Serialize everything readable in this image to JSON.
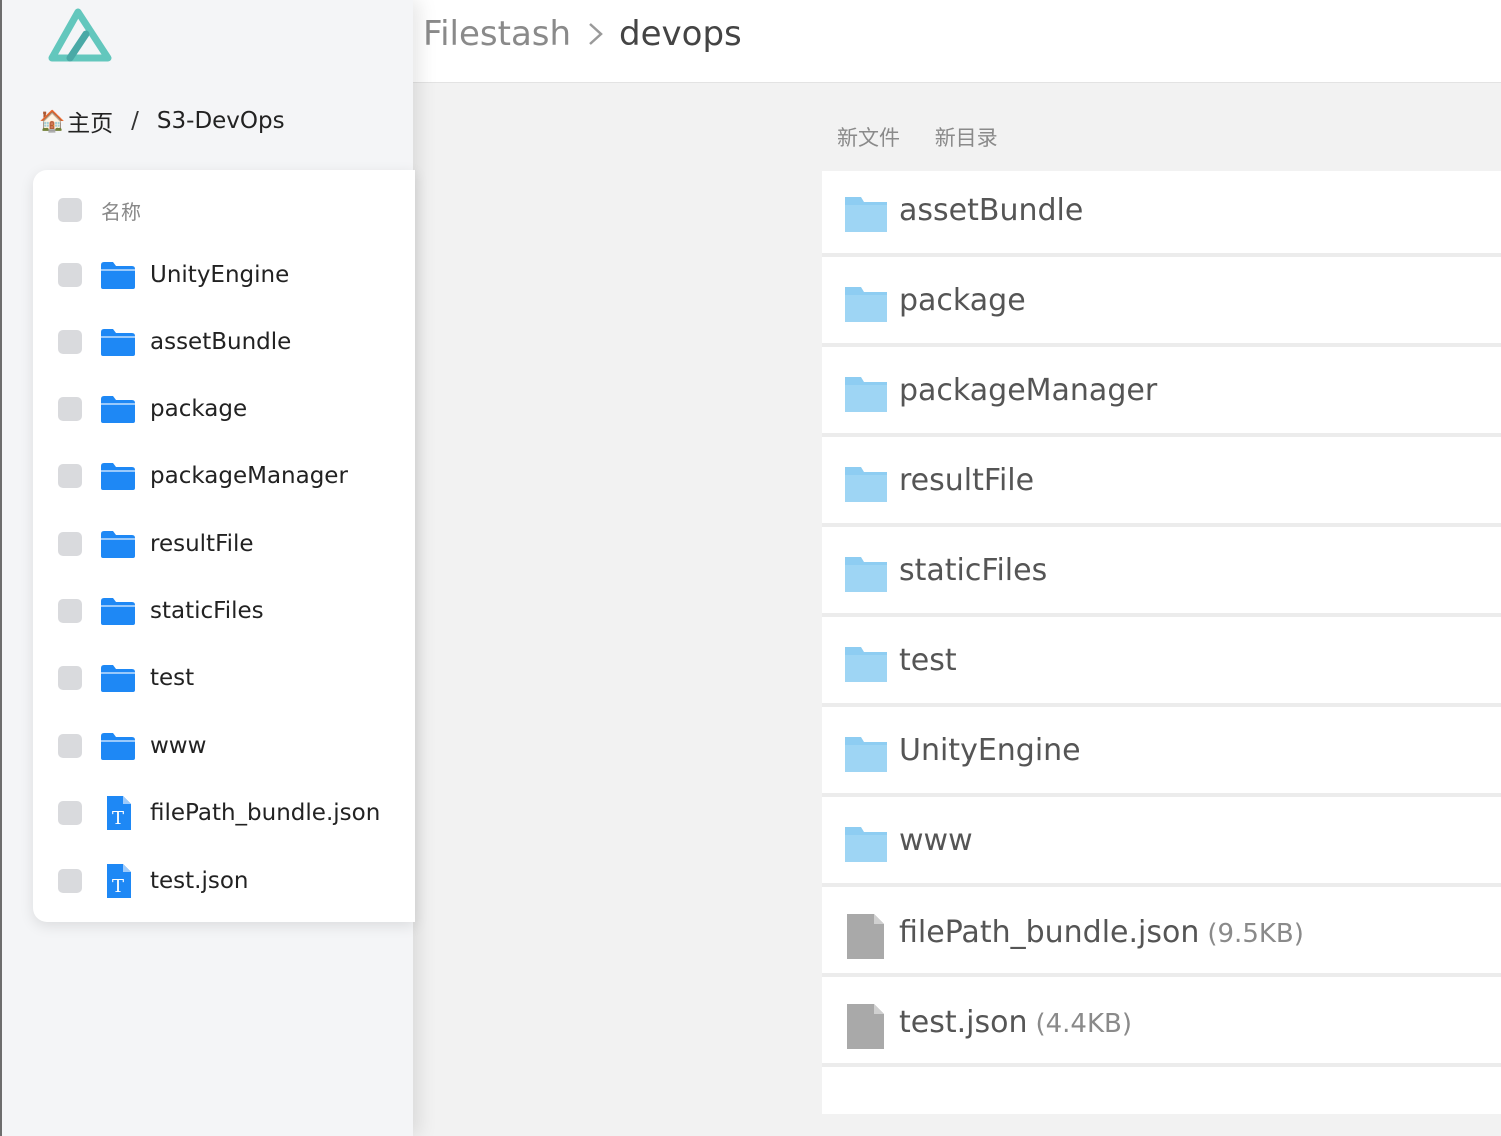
{
  "left": {
    "breadcrumb": {
      "home_icon": "🏠",
      "home": "主页",
      "separator": "/",
      "current": "S3-DevOps"
    },
    "table": {
      "header": "名称",
      "rows": [
        {
          "name": "UnityEngine",
          "type": "folder"
        },
        {
          "name": "assetBundle",
          "type": "folder"
        },
        {
          "name": "package",
          "type": "folder"
        },
        {
          "name": "packageManager",
          "type": "folder"
        },
        {
          "name": "resultFile",
          "type": "folder"
        },
        {
          "name": "staticFiles",
          "type": "folder"
        },
        {
          "name": "test",
          "type": "folder"
        },
        {
          "name": "www",
          "type": "folder"
        },
        {
          "name": "filePath_bundle.json",
          "type": "text-file"
        },
        {
          "name": "test.json",
          "type": "text-file"
        }
      ]
    }
  },
  "right": {
    "breadcrumb": {
      "app": "Filestash",
      "current": "devops"
    },
    "actions": {
      "new_file": "新文件",
      "new_folder": "新目录"
    },
    "files": [
      {
        "name": "assetBundle",
        "type": "folder",
        "size": ""
      },
      {
        "name": "package",
        "type": "folder",
        "size": ""
      },
      {
        "name": "packageManager",
        "type": "folder",
        "size": ""
      },
      {
        "name": "resultFile",
        "type": "folder",
        "size": ""
      },
      {
        "name": "staticFiles",
        "type": "folder",
        "size": ""
      },
      {
        "name": "test",
        "type": "folder",
        "size": ""
      },
      {
        "name": "UnityEngine",
        "type": "folder",
        "size": ""
      },
      {
        "name": "www",
        "type": "folder",
        "size": ""
      },
      {
        "name": "filePath_bundle.json",
        "type": "file",
        "size": "(9.5KB)"
      },
      {
        "name": "test.json",
        "type": "file",
        "size": "(4.4KB)"
      }
    ]
  },
  "colors": {
    "left_folder": "#1e88f5",
    "right_folder": "#8ecdf2",
    "file_icon": "#a9a9a9",
    "logo": "#63c7bd"
  }
}
